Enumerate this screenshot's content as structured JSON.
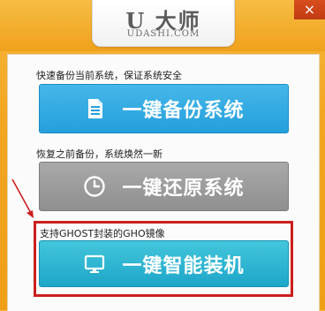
{
  "header": {
    "logo_mark": "U 大师",
    "logo_sub": "UDASHI.COM",
    "close_label": "×"
  },
  "backup": {
    "caption": "快速备份当前系统，保证系统安全",
    "button_label": "一键备份系统",
    "icon": "document-icon"
  },
  "restore": {
    "caption": "恢复之前备份，系统焕然一新",
    "button_label": "一键还原系统",
    "icon": "clock-icon"
  },
  "install": {
    "caption": "支持GHOST封装的GHO镜像",
    "button_label": "一键智能装机",
    "icon": "monitor-icon"
  },
  "colors": {
    "backup_button": "#249fdc",
    "restore_button": "#8f8f8f",
    "install_button": "#1ea6c8",
    "highlight_frame": "#cc1f1f",
    "window_bg": "#f2a521"
  }
}
